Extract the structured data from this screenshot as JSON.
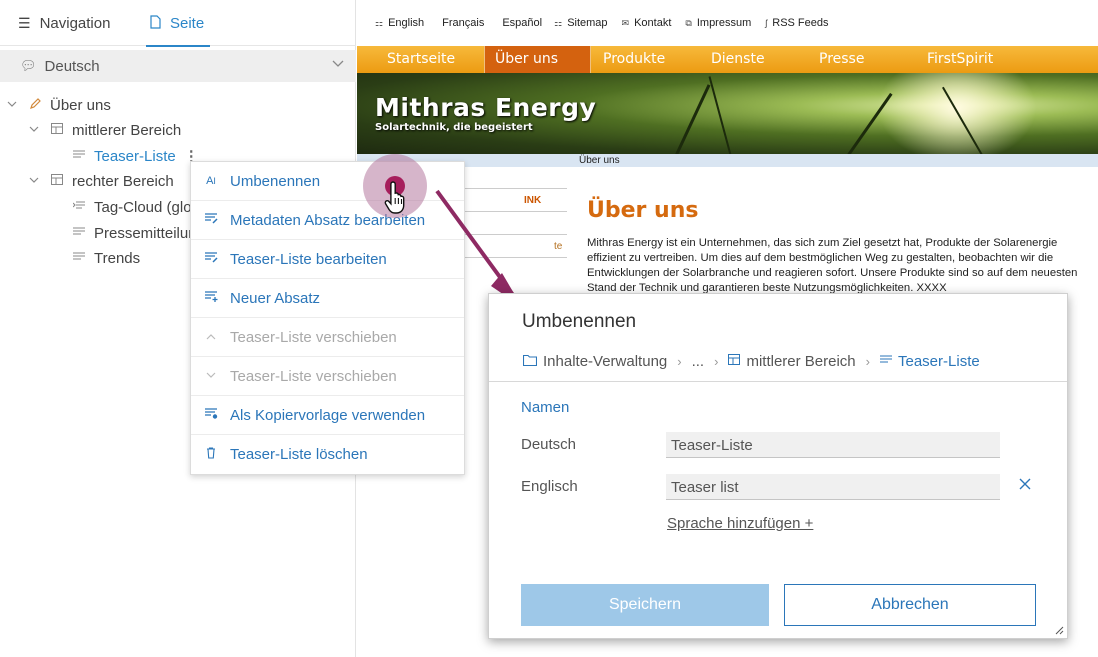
{
  "left_panel": {
    "tabs": {
      "navigation": "Navigation",
      "page": "Seite"
    },
    "language": "Deutsch",
    "tree": [
      {
        "label": "Über uns"
      },
      {
        "label": "mittlerer Bereich"
      },
      {
        "label": "Teaser-Liste"
      },
      {
        "label": "rechter Bereich"
      },
      {
        "label": "Tag-Cloud (glo"
      },
      {
        "label": "Pressemitteilun"
      },
      {
        "label": "Trends"
      }
    ]
  },
  "site": {
    "top_links": [
      "English",
      "Français",
      "Español",
      "Sitemap",
      "Kontakt",
      "Impressum",
      "RSS Feeds"
    ],
    "menu": [
      "Startseite",
      "Über uns",
      "Produkte",
      "Dienste",
      "Presse",
      "FirstSpirit"
    ],
    "menu_selected": "Über uns",
    "brand": "Mithras Energy",
    "tagline": "Solartechnik, die begeistert",
    "breadcrumb": "Über uns",
    "sidebox": [
      "INK",
      "te"
    ],
    "heading": "Über uns",
    "paragraph": "Mithras Energy ist ein Unternehmen, das sich zum Ziel gesetzt hat, Produkte der Solarenergie effizient zu vertreiben. Um dies auf dem bestmöglichen Weg zu gestalten, beobachten wir die Entwicklungen der Solarbranche und reagieren sofort. Unsere Produkte sind so auf dem neuesten Stand der Technik und garantieren beste Nutzungsmöglichkeiten. XXXX",
    "colors": {
      "menu": "#ec9b12",
      "menu_selected": "#d4620f",
      "heading": "#d56a0f"
    }
  },
  "context_menu": {
    "items": [
      {
        "label": "Umbenennen",
        "icon": "rename-icon",
        "enabled": true
      },
      {
        "label": "Metadaten Absatz bearbeiten",
        "icon": "edit-metadata-icon",
        "enabled": true
      },
      {
        "label": "Teaser-Liste bearbeiten",
        "icon": "edit-section-icon",
        "enabled": true
      },
      {
        "label": "Neuer Absatz",
        "icon": "new-section-icon",
        "enabled": true
      },
      {
        "label": "Teaser-Liste verschieben",
        "icon": "chevron-up-icon",
        "enabled": false
      },
      {
        "label": "Teaser-Liste verschieben",
        "icon": "chevron-down-icon",
        "enabled": false
      },
      {
        "label": "Als Kopiervorlage verwenden",
        "icon": "template-icon",
        "enabled": true
      },
      {
        "label": "Teaser-Liste löschen",
        "icon": "trash-icon",
        "enabled": true
      }
    ]
  },
  "dialog": {
    "title": "Umbenennen",
    "breadcrumb": {
      "root": "Inhalte-Verwaltung",
      "ellipsis": "...",
      "parent": "mittlerer Bereich",
      "current": "Teaser-Liste"
    },
    "section": "Namen",
    "fields": [
      {
        "label": "Deutsch",
        "value": "Teaser-Liste"
      },
      {
        "label": "Englisch",
        "value": "Teaser list"
      }
    ],
    "add_language": "Sprache hinzufügen +",
    "save": "Speichern",
    "cancel": "Abbrechen",
    "colors": {
      "accent": "#2b76b9",
      "save_bg": "#9ec8e8"
    }
  }
}
